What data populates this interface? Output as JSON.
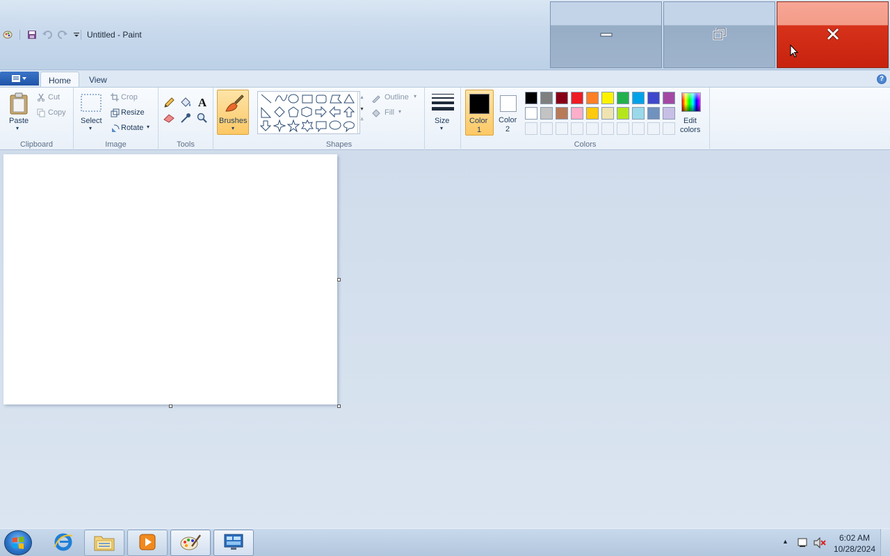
{
  "window": {
    "title": "Untitled - Paint",
    "controls": {
      "minimize": "minimize-icon",
      "maximize": "restore-icon",
      "close": "close-icon"
    }
  },
  "quick_access": [
    "paint-app-icon",
    "save-icon",
    "undo-icon",
    "redo-icon",
    "customize-dropdown-icon"
  ],
  "tabs": {
    "home": "Home",
    "view": "View"
  },
  "ribbon": {
    "clipboard": {
      "label": "Clipboard",
      "paste": "Paste",
      "cut": "Cut",
      "copy": "Copy"
    },
    "image": {
      "label": "Image",
      "select": "Select",
      "crop": "Crop",
      "resize": "Resize",
      "rotate": "Rotate"
    },
    "tools": {
      "label": "Tools"
    },
    "brushes": {
      "label": "Brushes"
    },
    "shapes": {
      "label": "Shapes",
      "outline": "Outline",
      "fill": "Fill"
    },
    "size": {
      "label": "Size"
    },
    "colors": {
      "label": "Colors",
      "color1": "Color",
      "color1_num": "1",
      "color2": "Color",
      "color2_num": "2",
      "edit": "Edit",
      "edit2": "colors",
      "color1_value": "#000000",
      "color2_value": "#ffffff",
      "palette_row1": [
        "#000000",
        "#7f7f7f",
        "#880015",
        "#ed1c24",
        "#ff7f27",
        "#fff200",
        "#22b14c",
        "#00a2e8",
        "#3f48cc",
        "#a349a4"
      ],
      "palette_row2": [
        "#ffffff",
        "#c3c3c3",
        "#b97a57",
        "#ffaec9",
        "#ffc90e",
        "#efe4b0",
        "#b5e61d",
        "#99d9ea",
        "#7092be",
        "#c8bfe7"
      ]
    }
  },
  "taskbar": {
    "apps": [
      "internet-explorer-icon",
      "file-explorer-icon",
      "media-player-icon",
      "paint-icon",
      "remote-desktop-icon"
    ],
    "time": "6:02 AM",
    "date": "10/28/2024"
  },
  "accent": {
    "close_red": "#c7220e",
    "selected_tool": "#fcd27a"
  }
}
